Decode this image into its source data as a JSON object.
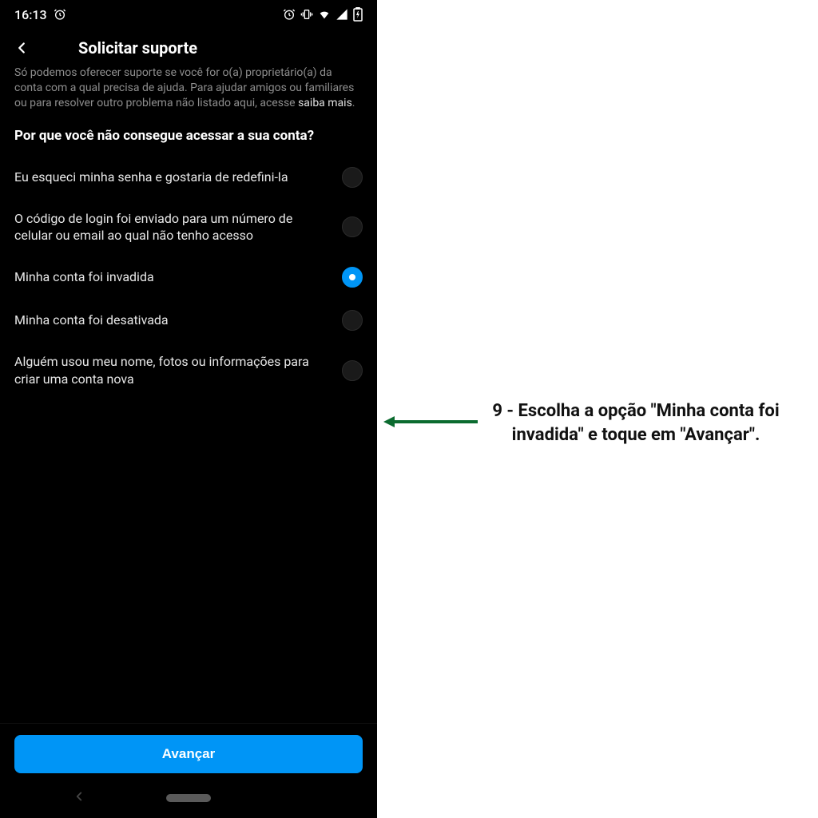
{
  "status_bar": {
    "time": "16:13"
  },
  "header": {
    "title": "Solicitar suporte"
  },
  "info": {
    "text_pre": "Só podemos oferecer suporte se você for o(a) proprietário(a) da conta com a qual precisa de ajuda. Para ajudar amigos ou familiares ou para resolver outro problema não listado aqui, acesse ",
    "link": "saiba mais",
    "text_post": "."
  },
  "question": "Por que você não consegue acessar a sua conta?",
  "options": [
    {
      "label": "Eu esqueci minha senha e gostaria de redefini-la",
      "selected": false
    },
    {
      "label": "O código de login foi enviado para um número de celular ou email ao qual não tenho acesso",
      "selected": false
    },
    {
      "label": "Minha conta foi invadida",
      "selected": true
    },
    {
      "label": "Minha conta foi desativada",
      "selected": false
    },
    {
      "label": "Alguém usou meu nome, fotos ou informações para criar uma conta nova",
      "selected": false
    }
  ],
  "footer": {
    "primary_button": "Avançar"
  },
  "annotation": {
    "text": "9 - Escolha a opção \"Minha conta foi invadida\" e toque em \"Avançar\"."
  }
}
